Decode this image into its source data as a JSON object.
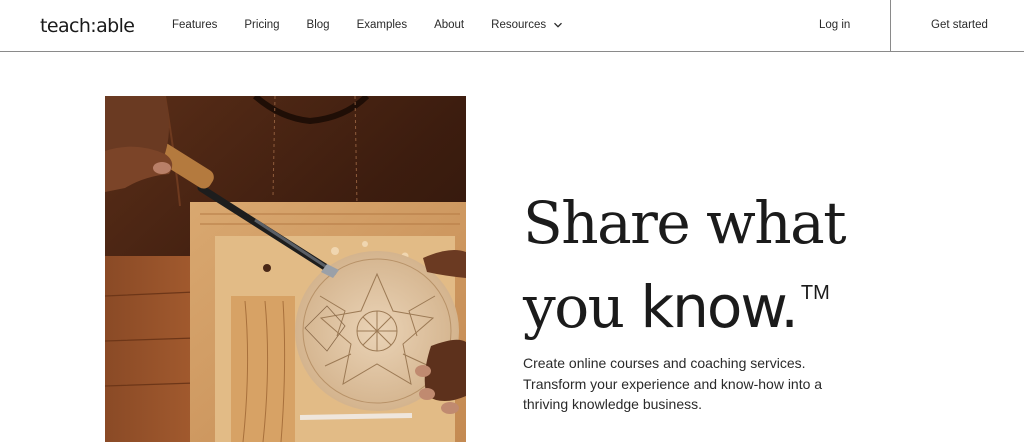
{
  "brand": {
    "logo_text": "teach:able"
  },
  "nav": {
    "links": [
      "Features",
      "Pricing",
      "Blog",
      "Examples",
      "About"
    ],
    "resources_label": "Resources",
    "login_label": "Log in",
    "cta_label": "Get started"
  },
  "hero": {
    "headline_line1": "Share what",
    "headline_line2_light": "you",
    "headline_line2_strong": "know.",
    "trademark": "TM",
    "subtext": "Create online courses and coaching services. Transform your experience and know-how into a thriving knowledge business.",
    "image_icon": "wood-carving-photo"
  },
  "colors": {
    "text": "#1b1b1b",
    "border": "#8a8a8a",
    "background": "#ffffff"
  }
}
